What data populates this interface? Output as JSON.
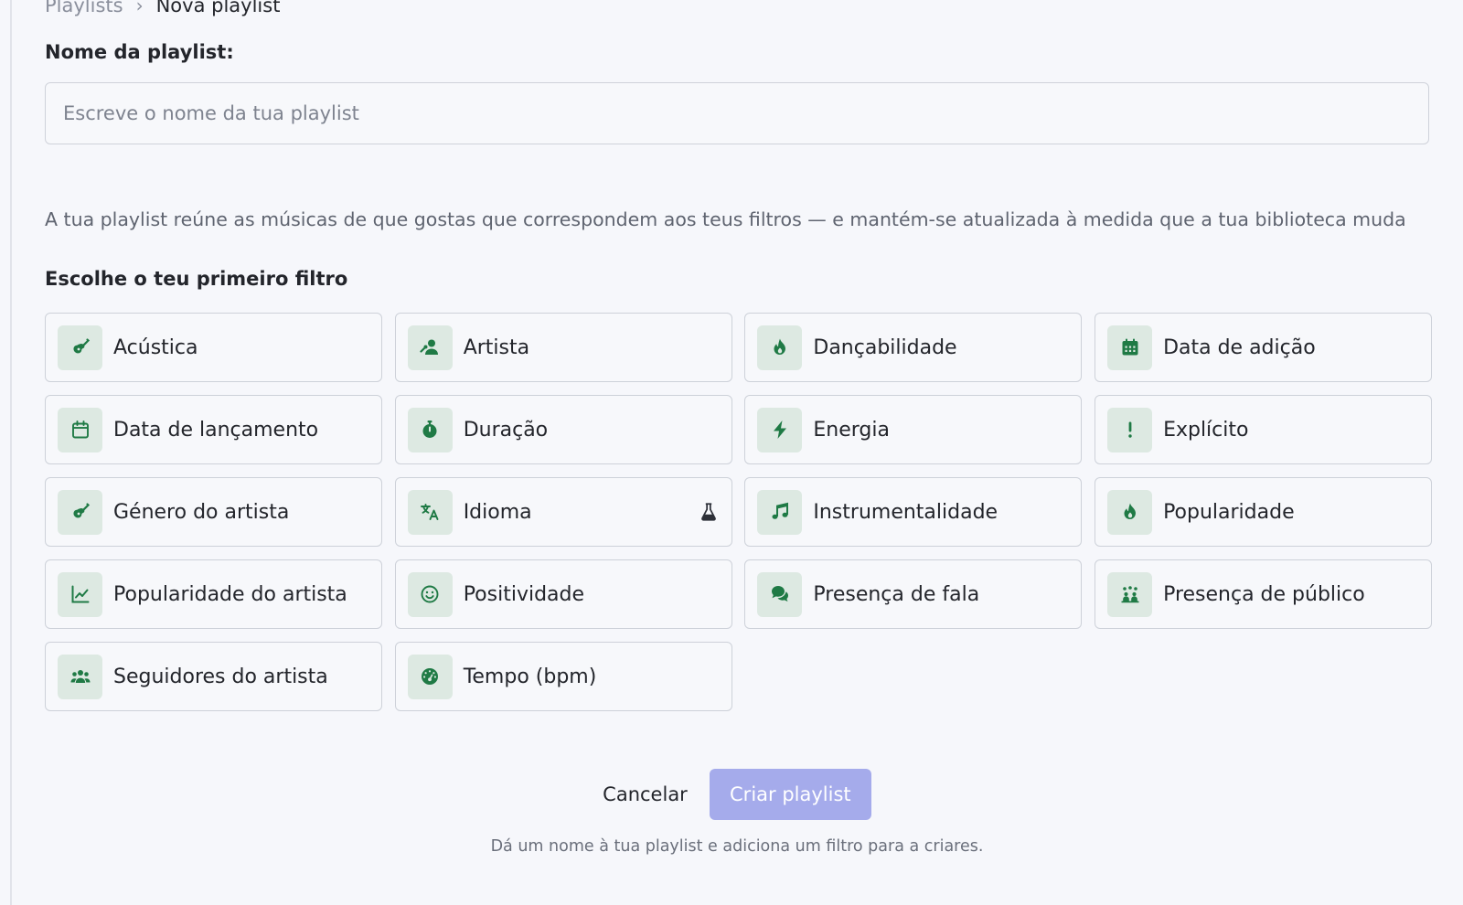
{
  "breadcrumb": {
    "parent": "Playlists",
    "separator": "›",
    "current": "Nova playlist"
  },
  "form": {
    "name_label": "Nome da playlist:",
    "name_placeholder": "Escreve o nome da tua playlist",
    "name_value": "",
    "description": "A tua playlist reúne as músicas de que gostas que correspondem aos teus filtros — e mantém-se atualizada à medida que a tua biblioteca muda",
    "filter_heading": "Escolhe o teu primeiro filtro"
  },
  "filters": [
    {
      "label": "Acústica",
      "icon": "guitar-icon"
    },
    {
      "label": "Artista",
      "icon": "artist-icon"
    },
    {
      "label": "Dançabilidade",
      "icon": "fire-icon"
    },
    {
      "label": "Data de adição",
      "icon": "calendar-filled-icon"
    },
    {
      "label": "Data de lançamento",
      "icon": "calendar-icon"
    },
    {
      "label": "Duração",
      "icon": "stopwatch-icon"
    },
    {
      "label": "Energia",
      "icon": "bolt-icon"
    },
    {
      "label": "Explícito",
      "icon": "exclamation-icon"
    },
    {
      "label": "Género do artista",
      "icon": "guitar-icon"
    },
    {
      "label": "Idioma",
      "icon": "translate-icon",
      "beta_icon": "flask-icon"
    },
    {
      "label": "Instrumentalidade",
      "icon": "music-note-icon"
    },
    {
      "label": "Popularidade",
      "icon": "fire-icon"
    },
    {
      "label": "Popularidade do artista",
      "icon": "line-chart-icon"
    },
    {
      "label": "Positividade",
      "icon": "smile-icon"
    },
    {
      "label": "Presença de fala",
      "icon": "chat-bubbles-icon"
    },
    {
      "label": "Presença de público",
      "icon": "audience-icon"
    },
    {
      "label": "Seguidores do artista",
      "icon": "users-icon"
    },
    {
      "label": "Tempo (bpm)",
      "icon": "gauge-icon"
    }
  ],
  "actions": {
    "cancel_label": "Cancelar",
    "create_label": "Criar playlist"
  },
  "hint": "Dá um nome à tua playlist e adiciona um filtro para a criares.",
  "colors": {
    "accent_green": "#1f7a45",
    "icon_background": "#dde9e2",
    "create_button": "#a5abeb",
    "page_background": "#f6f7fb"
  }
}
